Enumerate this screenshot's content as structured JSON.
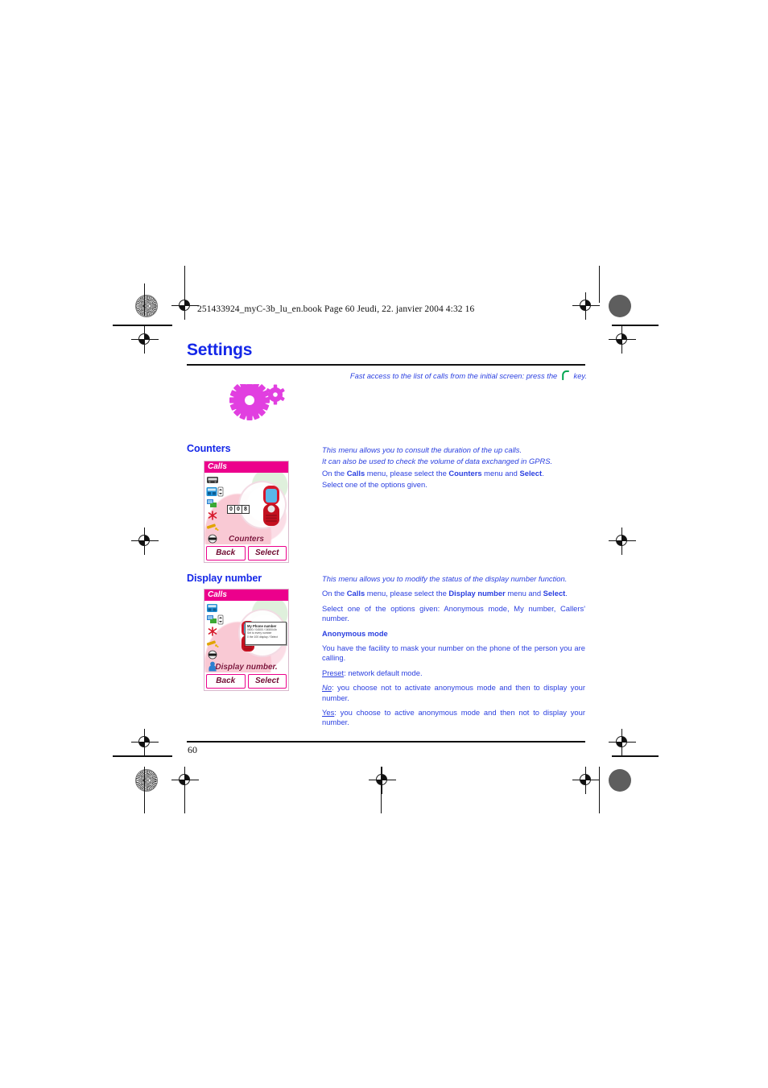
{
  "document": {
    "book_line": "251433924_myC-3b_lu_en.book  Page 60  Jeudi, 22. janvier 2004  4:32 16",
    "chapter_title": "Settings",
    "page_number": "60",
    "accent_blue": "#1427e8",
    "body_blue": "#2a3fe0",
    "accent_magenta": "#ec008c",
    "gear_color": "#e040d8"
  },
  "fast_access": {
    "text_before": "Fast access to the list of calls from the initial screen: press the",
    "icon": "green-handset-icon",
    "text_after": "key."
  },
  "sections": {
    "counters": {
      "heading": "Counters",
      "paragraphs": [
        "This menu allows you to consult the duration of the up calls.",
        "It can also be used to check the volume of data exchanged in GPRS.",
        "On the Calls menu, please select the Counters menu and Select.",
        "Select one of the options given."
      ],
      "screenshot": {
        "title": "Calls",
        "caption": "Counters",
        "counter_digits": [
          "0",
          "0",
          "8"
        ],
        "softkey_left": "Back",
        "softkey_right": "Select"
      }
    },
    "display_number": {
      "heading": "Display number",
      "paragraphs": [
        "This menu allows you to modify the status of the display number function.",
        "On the Calls menu, please select the Display number menu and Select.",
        "Select one of the options given: Anonymous mode, My number, Callers' number."
      ],
      "subsection": {
        "heading": "Anonymous mode",
        "intro": "You have the facility to mask your number on the phone of the person you are calling.",
        "options": [
          {
            "term": "Preset",
            "desc": ": network default mode."
          },
          {
            "term": "No",
            "desc": ": you choose not to activate anonymous mode and then to display your number."
          },
          {
            "term": "Yes",
            "desc": ": you choose to active anonymous mode and then not to display your number."
          }
        ]
      },
      "screenshot": {
        "title": "Calls",
        "caption": "Display number.",
        "dialog_title": "My Phone number",
        "dialog_sub1": "0800 / 04500 / 045004/b",
        "dialog_sub2": "Set to every number",
        "dialog_sub3": "0 the 100 display / Select",
        "softkey_left": "Back",
        "softkey_right": "Select"
      }
    }
  }
}
